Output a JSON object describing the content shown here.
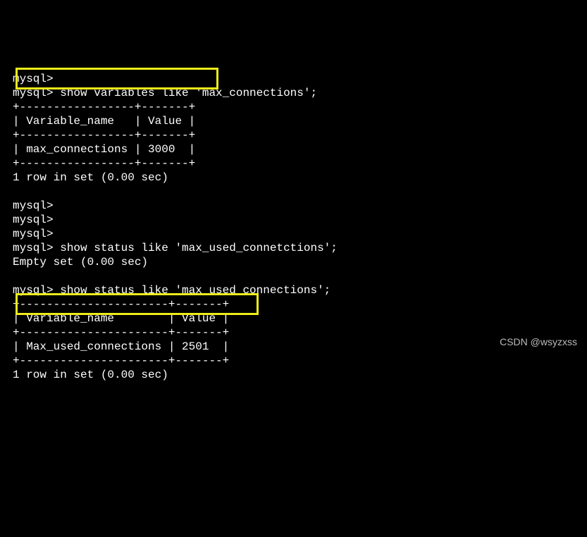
{
  "lines": {
    "l0": "mysql>",
    "l1": "mysql> show variables like 'max_connections';",
    "l2": "+-----------------+-------+",
    "l3": "| Variable_name   | Value |",
    "l4": "+-----------------+-------+",
    "l5": "| max_connections | 3000  |",
    "l6": "+-----------------+-------+",
    "l7": "1 row in set (0.00 sec)",
    "l8": "",
    "l9": "mysql>",
    "l10": "mysql>",
    "l11": "mysql>",
    "l12": "mysql> show status like 'max_used_connetctions';",
    "l13": "Empty set (0.00 sec)",
    "l14": "",
    "l15": "mysql> show status like 'max_used_connections';",
    "l16": "+----------------------+-------+",
    "l17": "| Variable_name        | Value |",
    "l18": "+----------------------+-------+",
    "l19": "| Max_used_connections | 2501  |",
    "l20": "+----------------------+-------+",
    "l21": "1 row in set (0.00 sec)",
    "l22": ""
  },
  "watermark": "CSDN @wsyzxss",
  "chart_data": [
    {
      "type": "table",
      "title": "show variables like 'max_connections'",
      "columns": [
        "Variable_name",
        "Value"
      ],
      "rows": [
        [
          "max_connections",
          3000
        ]
      ],
      "footer": "1 row in set (0.00 sec)"
    },
    {
      "type": "table",
      "title": "show status like 'max_used_connetctions'",
      "columns": [],
      "rows": [],
      "footer": "Empty set (0.00 sec)"
    },
    {
      "type": "table",
      "title": "show status like 'max_used_connections'",
      "columns": [
        "Variable_name",
        "Value"
      ],
      "rows": [
        [
          "Max_used_connections",
          2501
        ]
      ],
      "footer": "1 row in set (0.00 sec)"
    }
  ]
}
